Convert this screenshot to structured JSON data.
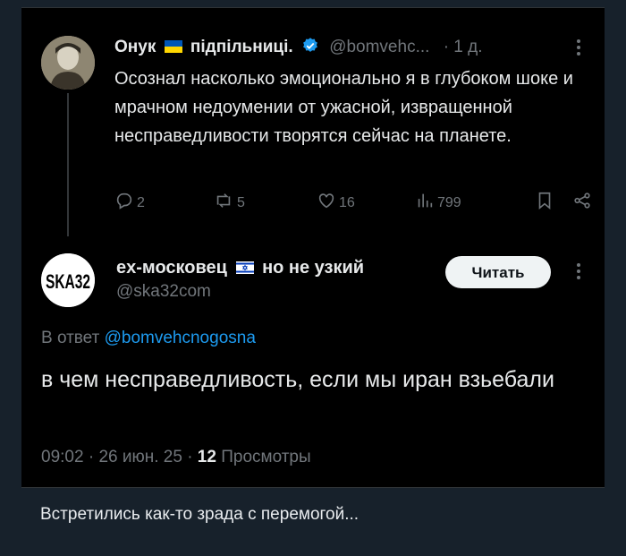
{
  "parent_tweet": {
    "name": "Онук",
    "name_suffix": "підпільниці.",
    "handle": "@bomvehc...",
    "separator": "·",
    "time": "1 д.",
    "text": "Осознал насколько эмоционально я в глубоком шоке и мрачном недоумении от ужасной, извращенной несправедливости творятся сейчас на планете.",
    "actions": {
      "replies": "2",
      "reposts": "5",
      "likes": "16",
      "views": "799"
    },
    "icons": [
      "reply-icon",
      "repost-icon",
      "like-icon",
      "views-icon",
      "bookmark-icon",
      "share-icon",
      "more-icon",
      "verified-icon"
    ]
  },
  "reply_tweet": {
    "name": "ex-московец",
    "name_suffix": "но не узкий",
    "handle": "@ska32com",
    "avatar_text": "SKA32",
    "follow_label": "Читать",
    "reply_prefix": "В ответ",
    "reply_to": "@bomvehcnogosna",
    "text": "в чем несправедливость, если мы иран взьебали",
    "time": "09:02",
    "date": "26 июн. 25",
    "views_count": "12",
    "views_label": "Просмотры",
    "meta_sep": "·"
  },
  "caption": "Встретились как-то зрада с перемогой...",
  "colors": {
    "background": "#17212b",
    "card": "#000000",
    "text": "#e7e9ea",
    "muted": "#71767b",
    "link": "#1d9bf0",
    "flag_ua_blue": "#0057b7",
    "flag_ua_yellow": "#ffd700",
    "verified": "#1d9bf0"
  }
}
